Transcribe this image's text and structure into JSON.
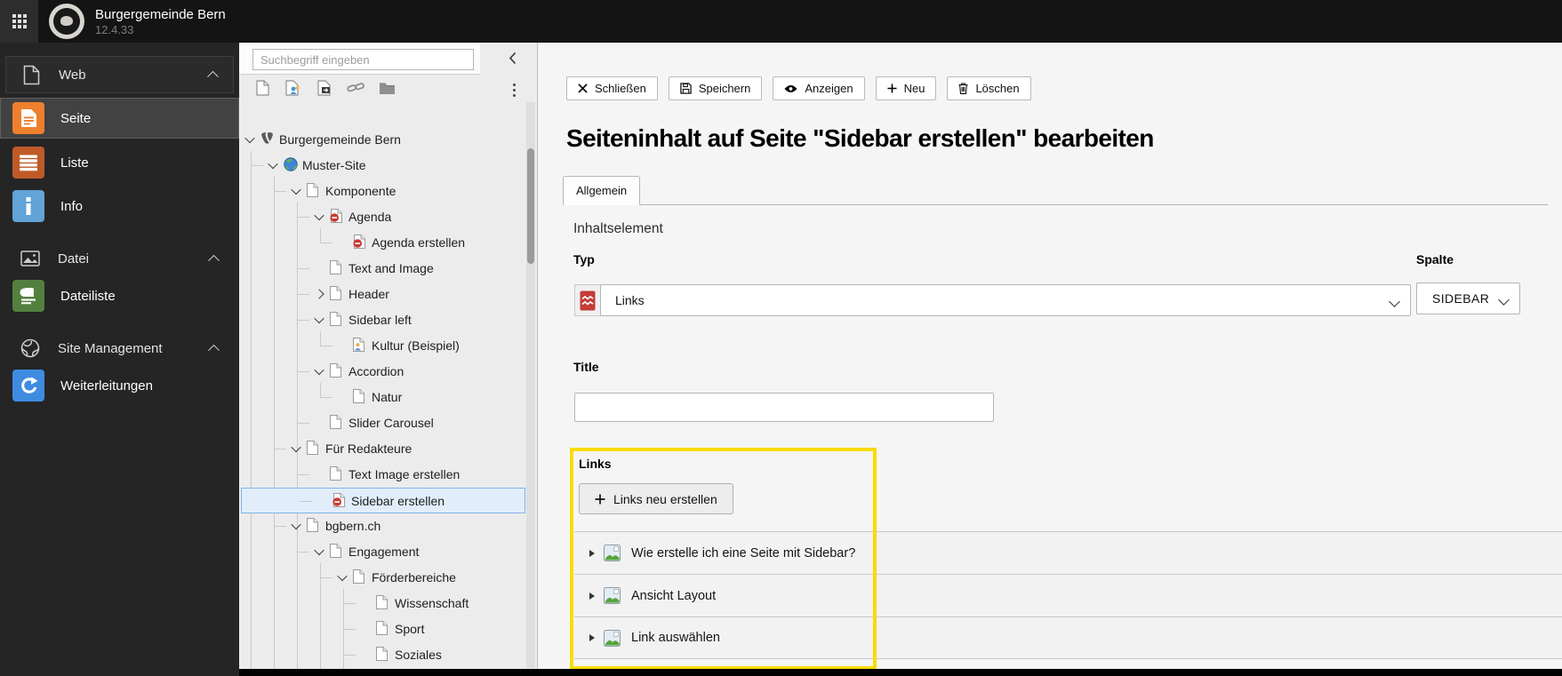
{
  "topbar": {
    "title": "Burgergemeinde Bern",
    "version": "12.4.33",
    "modules_icon": "grid-icon",
    "logo_icon": "burgergemeinde-seal-logo"
  },
  "colors": {
    "selection_highlight": "#e1edfa",
    "tutorial_highlight_border": "#f8dc00",
    "module_orange": "#ee7f2c",
    "module_rust": "#bf5a28",
    "module_blue": "#62a3d8",
    "module_green": "#53803f",
    "module_redirect_blue": "#3e8ce0"
  },
  "sidebar": {
    "groups": [
      {
        "label": "Web",
        "icon": "document-outline-icon",
        "chevron_icon": "chevron-up-icon",
        "items": [
          {
            "label": "Seite",
            "icon": "page-module-icon",
            "color": "#ee7f2c",
            "active": true
          },
          {
            "label": "Liste",
            "icon": "list-module-icon",
            "color": "#bf5a28",
            "active": false
          },
          {
            "label": "Info",
            "icon": "info-module-icon",
            "color": "#62a3d8",
            "active": false
          }
        ]
      },
      {
        "label": "Datei",
        "icon": "image-outline-icon",
        "chevron_icon": "chevron-up-icon",
        "items": [
          {
            "label": "Dateiliste",
            "icon": "filelist-module-icon",
            "color": "#53803f",
            "active": false
          }
        ]
      },
      {
        "label": "Site Management",
        "icon": "globe-outline-icon",
        "chevron_icon": "chevron-up-icon",
        "items": [
          {
            "label": "Weiterleitungen",
            "icon": "redirects-module-icon",
            "color": "#3e8ce0",
            "active": false
          }
        ]
      }
    ]
  },
  "pagetree": {
    "search_placeholder": "Suchbegriff eingeben",
    "collapse_icon": "chevron-left-icon",
    "menu_icon": "kebab-menu-icon",
    "toolbar_icons": [
      "new-page-icon",
      "new-shortcut-page-icon",
      "new-mountpoint-page-icon",
      "new-link-icon",
      "new-folder-icon"
    ],
    "nodes": [
      {
        "label": "Burgergemeinde Bern",
        "level": 0,
        "chevron": "down",
        "icon": "typo3-logo-icon",
        "selected": false
      },
      {
        "label": "Muster-Site",
        "level": 1,
        "chevron": "down",
        "icon": "site-globe-icon",
        "selected": false
      },
      {
        "label": "Komponente",
        "level": 2,
        "chevron": "down",
        "icon": "page-icon",
        "selected": false
      },
      {
        "label": "Agenda",
        "level": 3,
        "chevron": "down",
        "icon": "page-restricted-icon",
        "selected": false
      },
      {
        "label": "Agenda erstellen",
        "level": 4,
        "chevron": "none",
        "icon": "page-restricted-icon",
        "selected": false
      },
      {
        "label": "Text and Image",
        "level": 3,
        "chevron": "none",
        "icon": "page-icon",
        "selected": false
      },
      {
        "label": "Header",
        "level": 3,
        "chevron": "right",
        "icon": "page-icon",
        "selected": false
      },
      {
        "label": "Sidebar left",
        "level": 3,
        "chevron": "down",
        "icon": "page-icon",
        "selected": false
      },
      {
        "label": "Kultur (Beispiel)",
        "level": 4,
        "chevron": "none",
        "icon": "page-user-icon",
        "selected": false
      },
      {
        "label": "Accordion",
        "level": 3,
        "chevron": "down",
        "icon": "page-icon",
        "selected": false
      },
      {
        "label": "Natur",
        "level": 4,
        "chevron": "none",
        "icon": "page-icon",
        "selected": false
      },
      {
        "label": "Slider Carousel",
        "level": 3,
        "chevron": "none",
        "icon": "page-icon",
        "selected": false
      },
      {
        "label": "Für Redakteure",
        "level": 2,
        "chevron": "down",
        "icon": "page-icon",
        "selected": false
      },
      {
        "label": "Text Image erstellen",
        "level": 3,
        "chevron": "none",
        "icon": "page-icon",
        "selected": false
      },
      {
        "label": "Sidebar erstellen",
        "level": 3,
        "chevron": "none",
        "icon": "page-restricted-icon",
        "selected": true
      },
      {
        "label": "bgbern.ch",
        "level": 2,
        "chevron": "down",
        "icon": "page-icon",
        "selected": false
      },
      {
        "label": "Engagement",
        "level": 3,
        "chevron": "down",
        "icon": "page-icon",
        "selected": false
      },
      {
        "label": "Förderbereiche",
        "level": 4,
        "chevron": "down",
        "icon": "page-icon",
        "selected": false
      },
      {
        "label": "Wissenschaft",
        "level": 5,
        "chevron": "none",
        "icon": "page-icon",
        "selected": false
      },
      {
        "label": "Sport",
        "level": 5,
        "chevron": "none",
        "icon": "page-icon",
        "selected": false
      },
      {
        "label": "Soziales",
        "level": 5,
        "chevron": "none",
        "icon": "page-icon",
        "selected": false
      }
    ]
  },
  "docheader": {
    "buttons": [
      {
        "label": "Schließen",
        "icon": "close-icon"
      },
      {
        "label": "Speichern",
        "icon": "save-icon"
      },
      {
        "label": "Anzeigen",
        "icon": "view-icon"
      },
      {
        "label": "Neu",
        "icon": "plus-icon"
      },
      {
        "label": "Löschen",
        "icon": "trash-icon"
      }
    ]
  },
  "form": {
    "page_title": "Seiteninhalt auf Seite \"Sidebar erstellen\" bearbeiten",
    "tabs": [
      {
        "label": "Allgemein",
        "active": true
      }
    ],
    "section_heading": "Inhaltselement",
    "typ": {
      "label": "Typ",
      "value": "Links",
      "icon": "links-element-icon"
    },
    "spalte": {
      "label": "Spalte",
      "value": "SIDEBAR"
    },
    "title_field": {
      "label": "Title",
      "value": ""
    },
    "links": {
      "label": "Links",
      "create_button": "Links neu erstellen",
      "item_icon": "image-content-icon",
      "items": [
        "Wie erstelle ich eine Seite mit Sidebar?",
        "Ansicht Layout",
        "Link auswählen"
      ]
    }
  }
}
